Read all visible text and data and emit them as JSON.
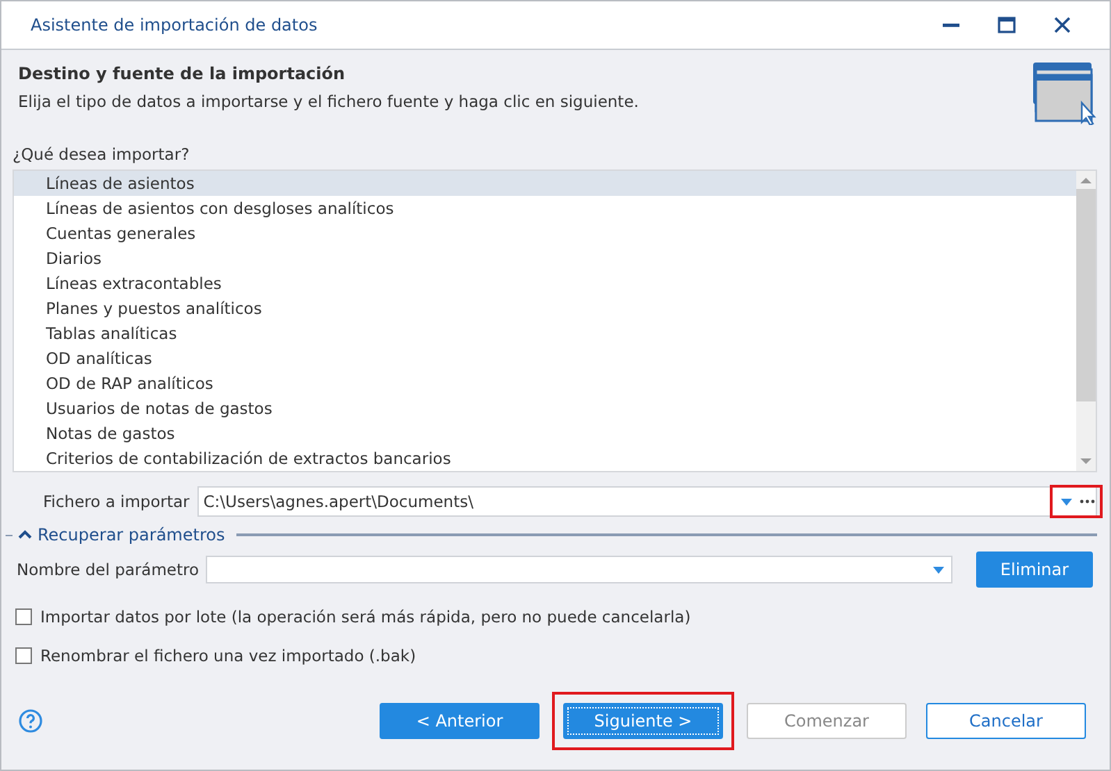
{
  "window": {
    "title": "Asistente de importación de datos"
  },
  "header": {
    "title": "Destino y fuente de la importación",
    "subtitle": "Elija el tipo de datos a importarse y el fichero fuente y haga clic en siguiente."
  },
  "import_list": {
    "label": "¿Qué desea importar?",
    "items": [
      {
        "label": "Líneas de asientos",
        "selected": true
      },
      {
        "label": "Líneas de asientos con desgloses analíticos",
        "selected": false
      },
      {
        "label": "Cuentas generales",
        "selected": false
      },
      {
        "label": "Diarios",
        "selected": false
      },
      {
        "label": "Líneas extracontables",
        "selected": false
      },
      {
        "label": "Planes y puestos analíticos",
        "selected": false
      },
      {
        "label": "Tablas analíticas",
        "selected": false
      },
      {
        "label": "OD analíticas",
        "selected": false
      },
      {
        "label": "OD de RAP analíticos",
        "selected": false
      },
      {
        "label": "Usuarios de notas de gastos",
        "selected": false
      },
      {
        "label": "Notas de gastos",
        "selected": false
      },
      {
        "label": "Criterios de contabilización de extractos bancarios",
        "selected": false
      }
    ]
  },
  "file_field": {
    "label": "Fichero a importar",
    "value": "C:\\Users\\agnes.apert\\Documents\\",
    "highlighted": true
  },
  "parameters": {
    "title": "Recuperar parámetros",
    "expanded": true,
    "name_label": "Nombre del parámetro",
    "delete_button": "Eliminar"
  },
  "options": [
    {
      "label": "Importar datos por lote (la operación será más rápida, pero no puede cancelarla)",
      "checked": false
    },
    {
      "label": "Renombrar el fichero una vez importado (.bak)",
      "checked": false
    }
  ],
  "buttons": [
    {
      "label": "< Anterior",
      "kind": "primary",
      "highlighted": false
    },
    {
      "label": "Siguiente >",
      "kind": "focused",
      "highlighted": true
    },
    {
      "label": "Comenzar",
      "kind": "disabled",
      "highlighted": false
    },
    {
      "label": "Cancelar",
      "kind": "outline",
      "highlighted": false
    }
  ]
}
